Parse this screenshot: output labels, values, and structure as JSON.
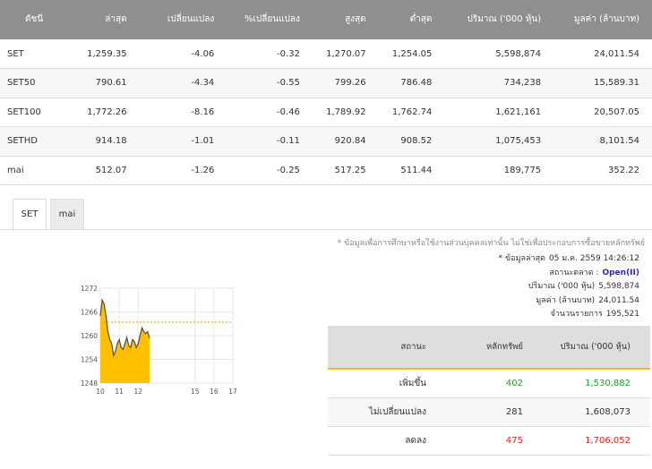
{
  "index_table": {
    "headers": [
      "ดัชนี",
      "ล่าสุด",
      "เปลี่ยนแปลง",
      "%เปลี่ยนแปลง",
      "สูงสุด",
      "ต่ำสุด",
      "ปริมาณ ('000 หุ้น)",
      "มูลค่า (ล้านบาท)"
    ],
    "rows": [
      {
        "name": "SET",
        "last": "1,259.35",
        "chg": "-4.06",
        "pct": "-0.32",
        "high": "1,270.07",
        "low": "1,254.05",
        "vol": "5,598,874",
        "val": "24,011.54",
        "link": false
      },
      {
        "name": "SET50",
        "last": "790.61",
        "chg": "-4.34",
        "pct": "-0.55",
        "high": "799.26",
        "low": "786.48",
        "vol": "734,238",
        "val": "15,589.31",
        "link": true
      },
      {
        "name": "SET100",
        "last": "1,772.26",
        "chg": "-8.16",
        "pct": "-0.46",
        "high": "1,789.92",
        "low": "1,762.74",
        "vol": "1,621,161",
        "val": "20,507.05",
        "link": true
      },
      {
        "name": "SETHD",
        "last": "914.18",
        "chg": "-1.01",
        "pct": "-0.11",
        "high": "920.84",
        "low": "908.52",
        "vol": "1,075,453",
        "val": "8,101.54",
        "link": true
      },
      {
        "name": "mai",
        "last": "512.07",
        "chg": "-1.26",
        "pct": "-0.25",
        "high": "517.25",
        "low": "511.44",
        "vol": "189,775",
        "val": "352.22",
        "link": false
      }
    ]
  },
  "tabs": [
    {
      "label": "SET",
      "active": true
    },
    {
      "label": "mai",
      "active": false
    }
  ],
  "note": "* ข้อมูลเพื่อการศึกษาหรือใช้งานส่วนบุคคลเท่านั้น ไม่ใช่เพื่อประกอบการซื้อขายหลักทรัพย์",
  "info": {
    "updated_label": "* ข้อมูลล่าสุด",
    "updated_value": "05 ม.ค. 2559 14:26:12",
    "status_label": "สถานะตลาด :",
    "status_value": "Open(II)",
    "volume_label": "ปริมาณ ('000 หุ้น)",
    "volume_value": "5,598,874",
    "value_label": "มูลค่า (ล้านบาท)",
    "value_value": "24,011.54",
    "trades_label": "จำนวนรายการ",
    "trades_value": "195,521"
  },
  "breadth_table": {
    "headers": [
      "สถานะ",
      "หลักทรัพย์",
      "ปริมาณ ('000 หุ้น)"
    ],
    "rows": [
      {
        "status": "เพิ่มขึ้น",
        "count": "402",
        "volume": "1,530,882",
        "tone": "green"
      },
      {
        "status": "ไม่เปลี่ยนแปลง",
        "count": "281",
        "volume": "1,608,073",
        "tone": "neutral"
      },
      {
        "status": "ลดลง",
        "count": "475",
        "volume": "1,706,052",
        "tone": "red"
      }
    ]
  },
  "colors": {
    "header_bg": "#8f8f8f",
    "accent": "#f5b81e",
    "area_fill": "#ffc000",
    "negative": "#e02020",
    "positive": "#2a9a2a",
    "link": "#3b78c4"
  },
  "chart_data": {
    "type": "area",
    "x_ticks": [
      "10",
      "11",
      "12",
      "15",
      "16",
      "17"
    ],
    "y_ticks": [
      "1248",
      "1254",
      "1260",
      "1266",
      "1272"
    ],
    "ylim": [
      1248,
      1272
    ],
    "xlim": [
      10,
      17
    ],
    "reference_line": 1263.41,
    "x": [
      10.0,
      10.1,
      10.2,
      10.3,
      10.4,
      10.5,
      10.6,
      10.7,
      10.8,
      10.9,
      11.0,
      11.1,
      11.2,
      11.3,
      11.4,
      11.5,
      11.6,
      11.7,
      11.8,
      11.9,
      12.0,
      12.1,
      12.2,
      12.3,
      12.4,
      12.5,
      12.6
    ],
    "y": [
      1265.0,
      1269.0,
      1268.0,
      1265.0,
      1261.0,
      1259.0,
      1258.0,
      1255.0,
      1256.0,
      1258.0,
      1259.0,
      1257.0,
      1256.5,
      1258.0,
      1259.5,
      1257.5,
      1257.0,
      1259.0,
      1258.5,
      1257.0,
      1258.0,
      1260.0,
      1262.0,
      1261.0,
      1260.5,
      1261.0,
      1259.35
    ]
  }
}
